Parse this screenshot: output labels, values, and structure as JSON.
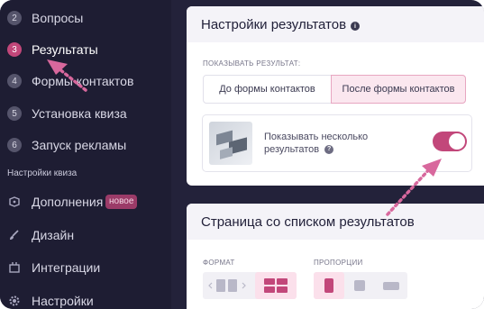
{
  "sidebar": {
    "steps": [
      {
        "num": "2",
        "label": "Вопросы"
      },
      {
        "num": "3",
        "label": "Результаты"
      },
      {
        "num": "4",
        "label": "Формы контактов"
      },
      {
        "num": "5",
        "label": "Установка квиза"
      },
      {
        "num": "6",
        "label": "Запуск рекламы"
      }
    ],
    "section_title": "Настройки квиза",
    "settings": [
      {
        "label": "Дополнения",
        "icon": "puzzle-icon"
      },
      {
        "label": "Дизайн",
        "icon": "brush-icon"
      },
      {
        "label": "Интеграции",
        "icon": "integrations-icon"
      },
      {
        "label": "Настройки",
        "icon": "gear-icon"
      }
    ],
    "badge": "новое"
  },
  "results_settings": {
    "title": "Настройки результатов",
    "show_label": "ПОКАЗЫВАТЬ РЕЗУЛЬТАТ:",
    "option_before": "До формы контактов",
    "option_after": "После формы контактов",
    "multi_text": "Показывать несколько результатов",
    "multi_enabled": true
  },
  "results_list_page": {
    "title": "Страница со списком результатов",
    "format_label": "ФОРМАТ",
    "proportions_label": "ПРОПОРЦИИ"
  },
  "colors": {
    "accent": "#c2477a",
    "sidebar_bg": "#1e1d33",
    "arrow": "#d8689d"
  }
}
